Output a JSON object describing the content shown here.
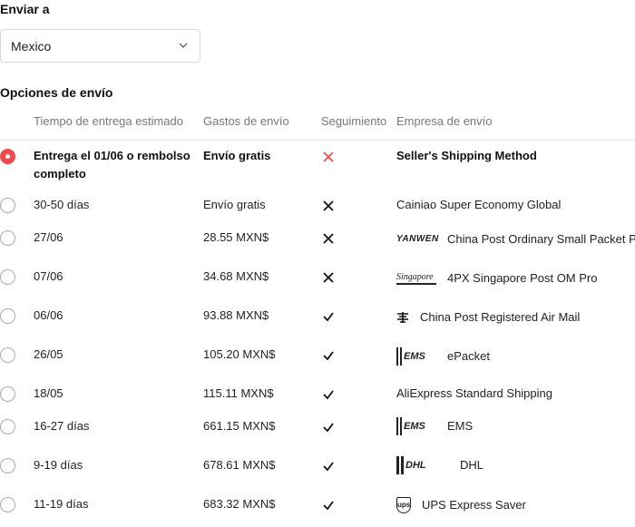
{
  "send_to": {
    "title": "Enviar a",
    "country": "Mexico"
  },
  "shipping": {
    "title": "Opciones de envío",
    "headers": {
      "time": "Tiempo de entrega estimado",
      "cost": "Gastos de envío",
      "tracking": "Seguimiento",
      "company": "Empresa de envío"
    },
    "rows": [
      {
        "time": "Entrega el 01/06 o rembolso completo",
        "cost": "Envío gratis",
        "tracking": "no",
        "company": "Seller's Shipping Method",
        "selected": true,
        "logo": ""
      },
      {
        "time": "30-50 días",
        "cost": "Envío gratis",
        "tracking": "no",
        "company": "Cainiao Super Economy Global",
        "selected": false,
        "logo": ""
      },
      {
        "time": "27/06",
        "cost": "28.55 MXN$",
        "tracking": "no",
        "company": "China Post Ordinary Small Packet Plus",
        "selected": false,
        "logo": "yanwen-logo"
      },
      {
        "time": "07/06",
        "cost": "34.68 MXN$",
        "tracking": "no",
        "company": "4PX Singapore Post OM Pro",
        "selected": false,
        "logo": "singapore-post-logo"
      },
      {
        "time": "06/06",
        "cost": "93.88 MXN$",
        "tracking": "yes",
        "company": "China Post Registered Air Mail",
        "selected": false,
        "logo": "china-post-logo"
      },
      {
        "time": "26/05",
        "cost": "105.20 MXN$",
        "tracking": "yes",
        "company": "ePacket",
        "selected": false,
        "logo": "ems-logo"
      },
      {
        "time": "18/05",
        "cost": "115.11 MXN$",
        "tracking": "yes",
        "company": "AliExpress Standard Shipping",
        "selected": false,
        "logo": ""
      },
      {
        "time": "16-27 días",
        "cost": "661.15 MXN$",
        "tracking": "yes",
        "company": "EMS",
        "selected": false,
        "logo": "ems-logo"
      },
      {
        "time": "9-19 días",
        "cost": "678.61 MXN$",
        "tracking": "yes",
        "company": "DHL",
        "selected": false,
        "logo": "dhl-logo"
      },
      {
        "time": "11-19 días",
        "cost": "683.32 MXN$",
        "tracking": "yes",
        "company": "UPS Express Saver",
        "selected": false,
        "logo": "ups-logo"
      }
    ]
  },
  "logos": {
    "yanwen": "YANWEN",
    "singapore": "Singapore",
    "ems": "EMS",
    "dhl": "DHL",
    "ups": "ups"
  },
  "colors": {
    "accent": "#f04a4a"
  }
}
